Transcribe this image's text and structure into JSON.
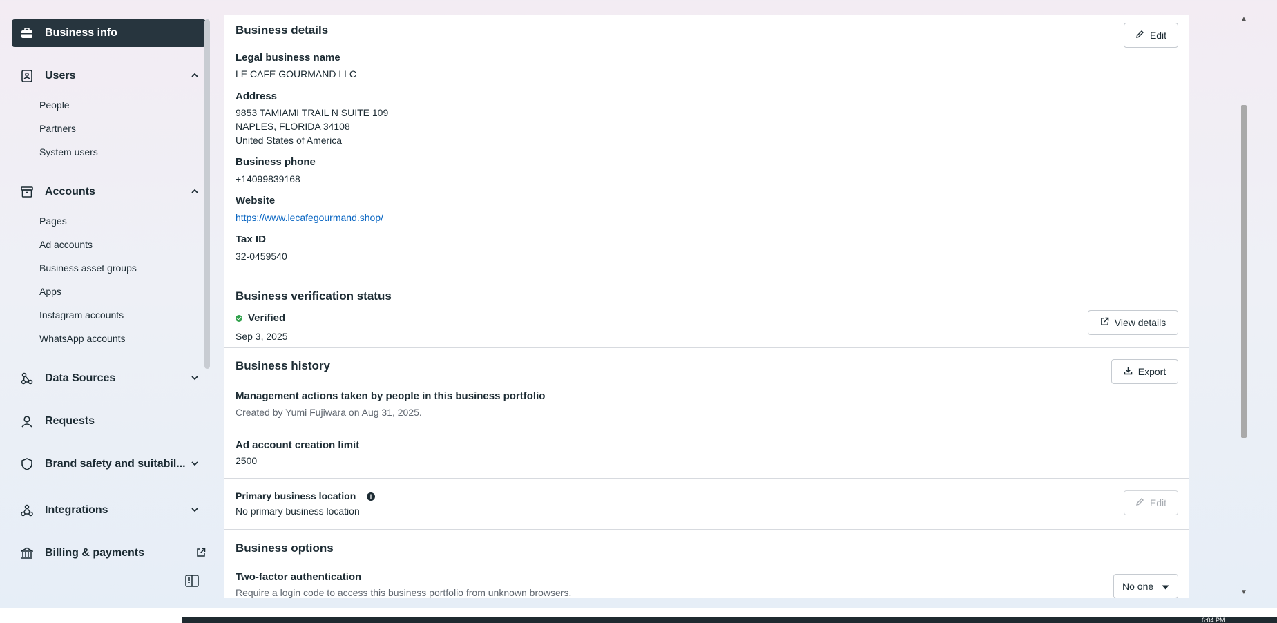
{
  "sidebar": {
    "active": "Business info",
    "users": {
      "label": "Users",
      "items": [
        "People",
        "Partners",
        "System users"
      ]
    },
    "accounts": {
      "label": "Accounts",
      "items": [
        "Pages",
        "Ad accounts",
        "Business asset groups",
        "Apps",
        "Instagram accounts",
        "WhatsApp accounts"
      ]
    },
    "data_sources": "Data Sources",
    "requests": "Requests",
    "brand_safety": "Brand safety and suitabil...",
    "integrations": "Integrations",
    "billing": "Billing & payments"
  },
  "details": {
    "title": "Business details",
    "edit": "Edit",
    "legal_name_label": "Legal business name",
    "legal_name": "LE CAFE GOURMAND LLC",
    "address_label": "Address",
    "address_line1": "9853 TAMIAMI TRAIL N SUITE 109",
    "address_line2": "NAPLES, FLORIDA 34108",
    "address_line3": "United States of America",
    "phone_label": "Business phone",
    "phone": "+14099839168",
    "website_label": "Website",
    "website": "https://www.lecafegourmand.shop/",
    "taxid_label": "Tax ID",
    "taxid": "32-0459540"
  },
  "verification": {
    "title": "Business verification status",
    "status": "Verified",
    "date": "Sep 3, 2025",
    "button": "View details"
  },
  "history": {
    "title": "Business history",
    "button": "Export",
    "subtitle": "Management actions taken by people in this business portfolio",
    "created": "Created by Yumi Fujiwara on Aug 31, 2025."
  },
  "ad_limit": {
    "title": "Ad account creation limit",
    "value": "2500"
  },
  "location": {
    "title": "Primary business location",
    "value": "No primary business location",
    "button": "Edit"
  },
  "options": {
    "title": "Business options",
    "tfa_title": "Two-factor authentication",
    "tfa_desc": "Require a login code to access this business portfolio from unknown browsers.",
    "tfa_value": "No one"
  },
  "taskbar": {
    "clock": "6:04 PM"
  }
}
